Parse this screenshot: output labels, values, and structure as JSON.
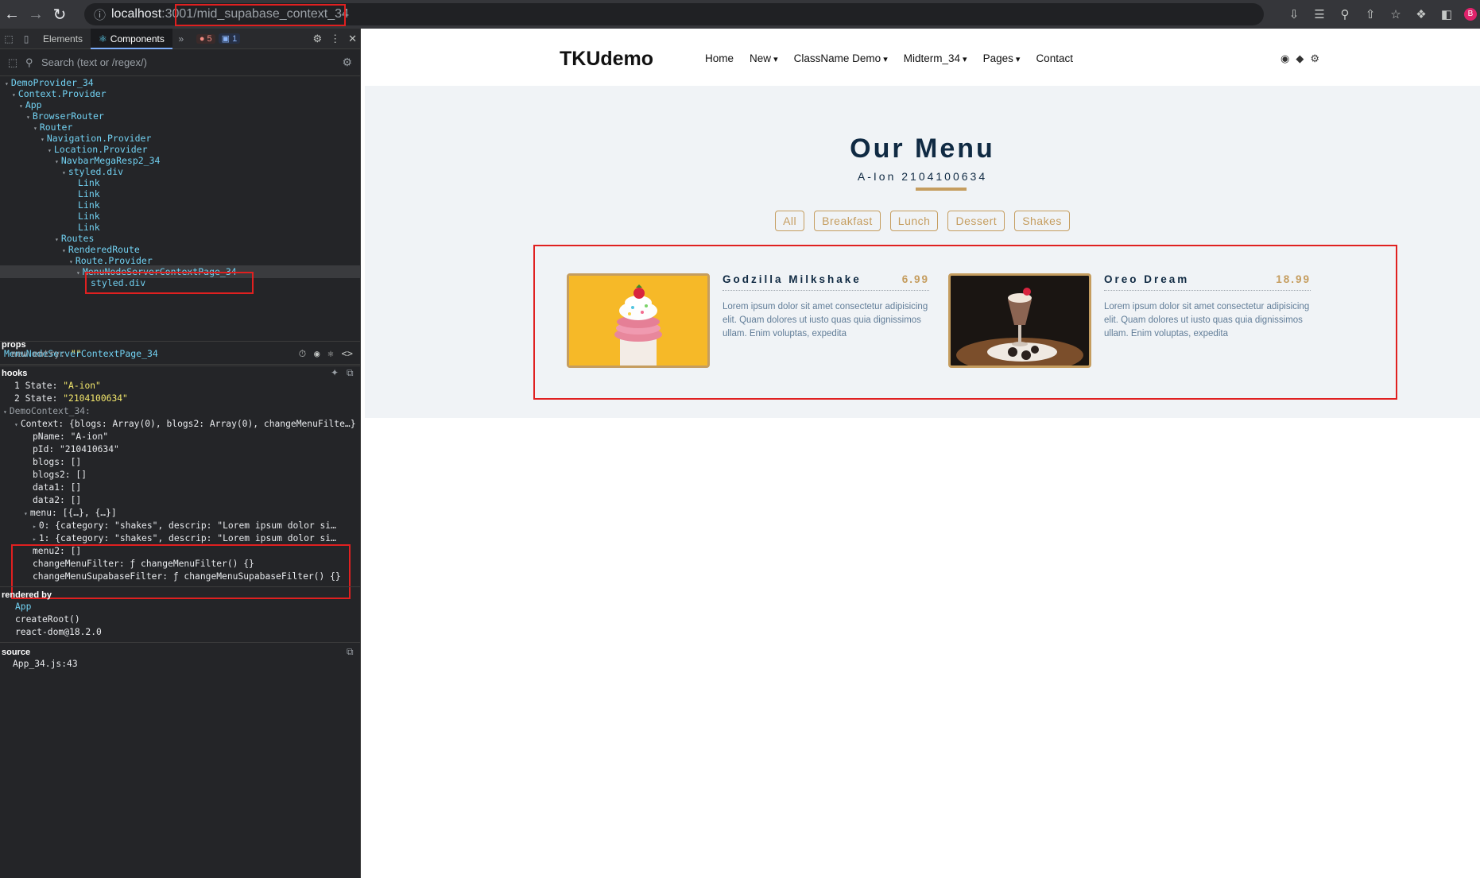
{
  "browser": {
    "url_host": "localhost",
    "url_rest": ":3001/mid_supabase_context_34"
  },
  "devtools": {
    "tabs": [
      {
        "label": "Elements"
      },
      {
        "label": "Components"
      }
    ],
    "error_count": "5",
    "info_count": "1",
    "search_placeholder": "Search (text or /regex/)",
    "tree": [
      {
        "label": "DemoProvider_34"
      },
      {
        "label": "Context.Provider"
      },
      {
        "label": "App"
      },
      {
        "label": "BrowserRouter"
      },
      {
        "label": "Router"
      },
      {
        "label": "Navigation.Provider"
      },
      {
        "label": "Location.Provider"
      },
      {
        "label": "NavbarMegaResp2_34"
      },
      {
        "label": "styled.div"
      },
      {
        "label": "Link"
      },
      {
        "label": "Link"
      },
      {
        "label": "Link"
      },
      {
        "label": "Link"
      },
      {
        "label": "Link"
      },
      {
        "label": "Routes"
      },
      {
        "label": "RenderedRoute"
      },
      {
        "label": "Route.Provider"
      },
      {
        "label": "MenuNodeServerContextPage_34"
      },
      {
        "label": "styled.div"
      }
    ],
    "selected_component": "MenuNodeServerContextPage_34",
    "props_label": "props",
    "props_new_entry": "new entry:",
    "props_new_value": "\"\"",
    "hooks_label": "hooks",
    "hook1_label": "1 State:",
    "hook1_value": "\"A-ion\"",
    "hook2_label": "2 State:",
    "hook2_value": "\"2104100634\"",
    "context_name": "DemoContext_34:",
    "context_summary": "Context: {blogs: Array(0), blogs2: Array(0), changeMenuFilte…}",
    "ctx_pname": "pName: \"A-ion\"",
    "ctx_pid": "pId: \"210410634\"",
    "ctx_blogs": "blogs: []",
    "ctx_blogs2": "blogs2: []",
    "ctx_data1": "data1: []",
    "ctx_data2": "data2: []",
    "ctx_menu": "menu: [{…}, {…}]",
    "ctx_menu0": "0: {category: \"shakes\", descrip: \"Lorem ipsum dolor si…",
    "ctx_menu1": "1: {category: \"shakes\", descrip: \"Lorem ipsum dolor si…",
    "ctx_menu2": "menu2: []",
    "ctx_fn1": "changeMenuFilter: ƒ changeMenuFilter() {}",
    "ctx_fn2": "changeMenuSupabaseFilter: ƒ changeMenuSupabaseFilter() {}",
    "rendered_by_label": "rendered by",
    "rendered_by": [
      "App",
      "createRoot()",
      "react-dom@18.2.0"
    ],
    "source_label": "source",
    "source_value": "App_34.js:43"
  },
  "page": {
    "brand": "TKUdemo",
    "nav": [
      "Home",
      "New",
      "ClassName Demo",
      "Midterm_34",
      "Pages",
      "Contact"
    ],
    "title": "Our Menu",
    "subtitle": "A-Ion 2104100634",
    "filters": [
      "All",
      "Breakfast",
      "Lunch",
      "Dessert",
      "Shakes"
    ],
    "items": [
      {
        "name": "Godzilla Milkshake",
        "price": "6.99",
        "desc": "Lorem ipsum dolor sit amet consectetur adipisicing elit. Quam dolores ut iusto quas quia dignissimos ullam. Enim voluptas, expedita"
      },
      {
        "name": "Oreo Dream",
        "price": "18.99",
        "desc": "Lorem ipsum dolor sit amet consectetur adipisicing elit. Quam dolores ut iusto quas quia dignissimos ullam. Enim voluptas, expedita"
      }
    ]
  },
  "colors": {
    "accent_gold": "#c59d5f",
    "heading_navy": "#102a43",
    "highlight_red": "#e02020",
    "react_cyan": "#72d2f3"
  }
}
